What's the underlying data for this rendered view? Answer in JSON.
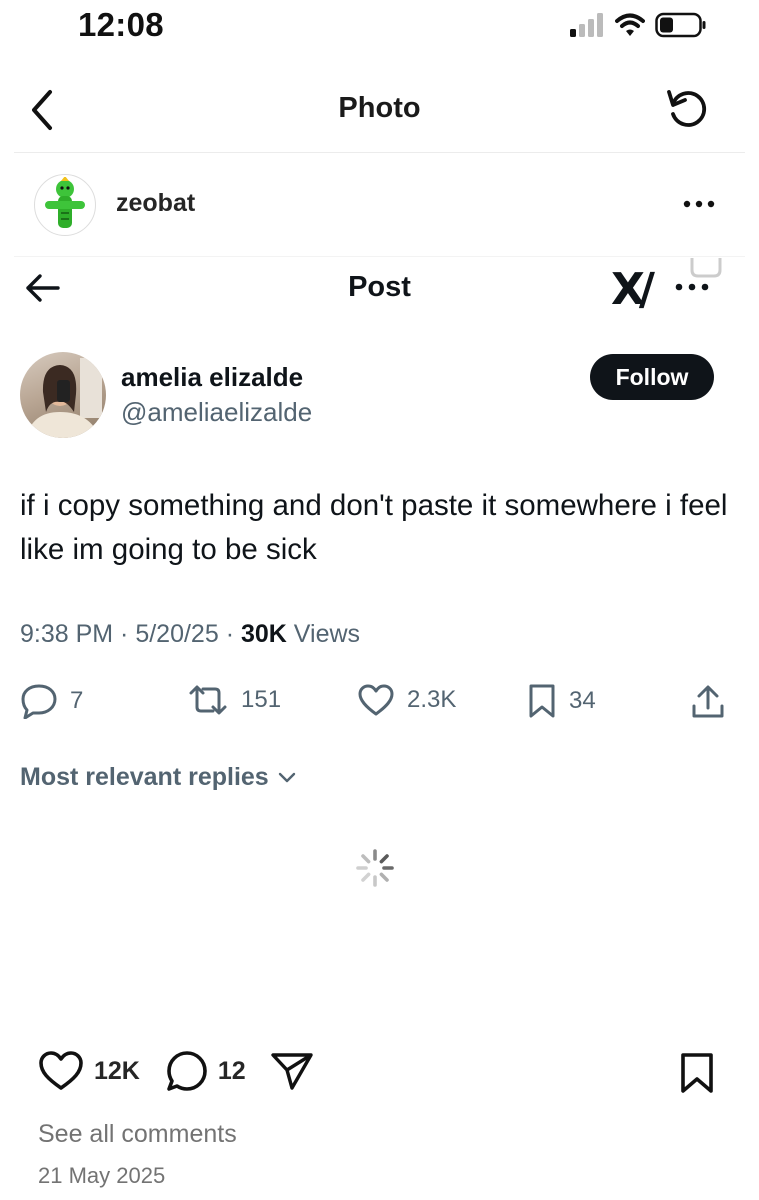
{
  "status_bar": {
    "time": "12:08"
  },
  "photo_header": {
    "title": "Photo"
  },
  "ig_post": {
    "username": "zeobat",
    "likes": "12K",
    "comments": "12",
    "see_all_comments": "See all comments",
    "date": "21 May 2025"
  },
  "x_post": {
    "header_title": "Post",
    "logo_text": "X∕",
    "display_name": "amelia elizalde",
    "handle": "@ameliaelizalde",
    "follow_label": "Follow",
    "text": "if i copy something and don't paste it somewhere i feel like im going to be sick",
    "time": "9:38 PM",
    "date": "5/20/25",
    "views_count": "30K",
    "views_label": "Views",
    "replies": "7",
    "reposts": "151",
    "likes": "2.3K",
    "bookmarks": "34",
    "replies_sort": "Most relevant replies"
  },
  "colors": {
    "text_primary": "#0f1419",
    "text_secondary": "#536471",
    "ig_secondary": "#737373",
    "follow_bg": "#0f1419"
  }
}
